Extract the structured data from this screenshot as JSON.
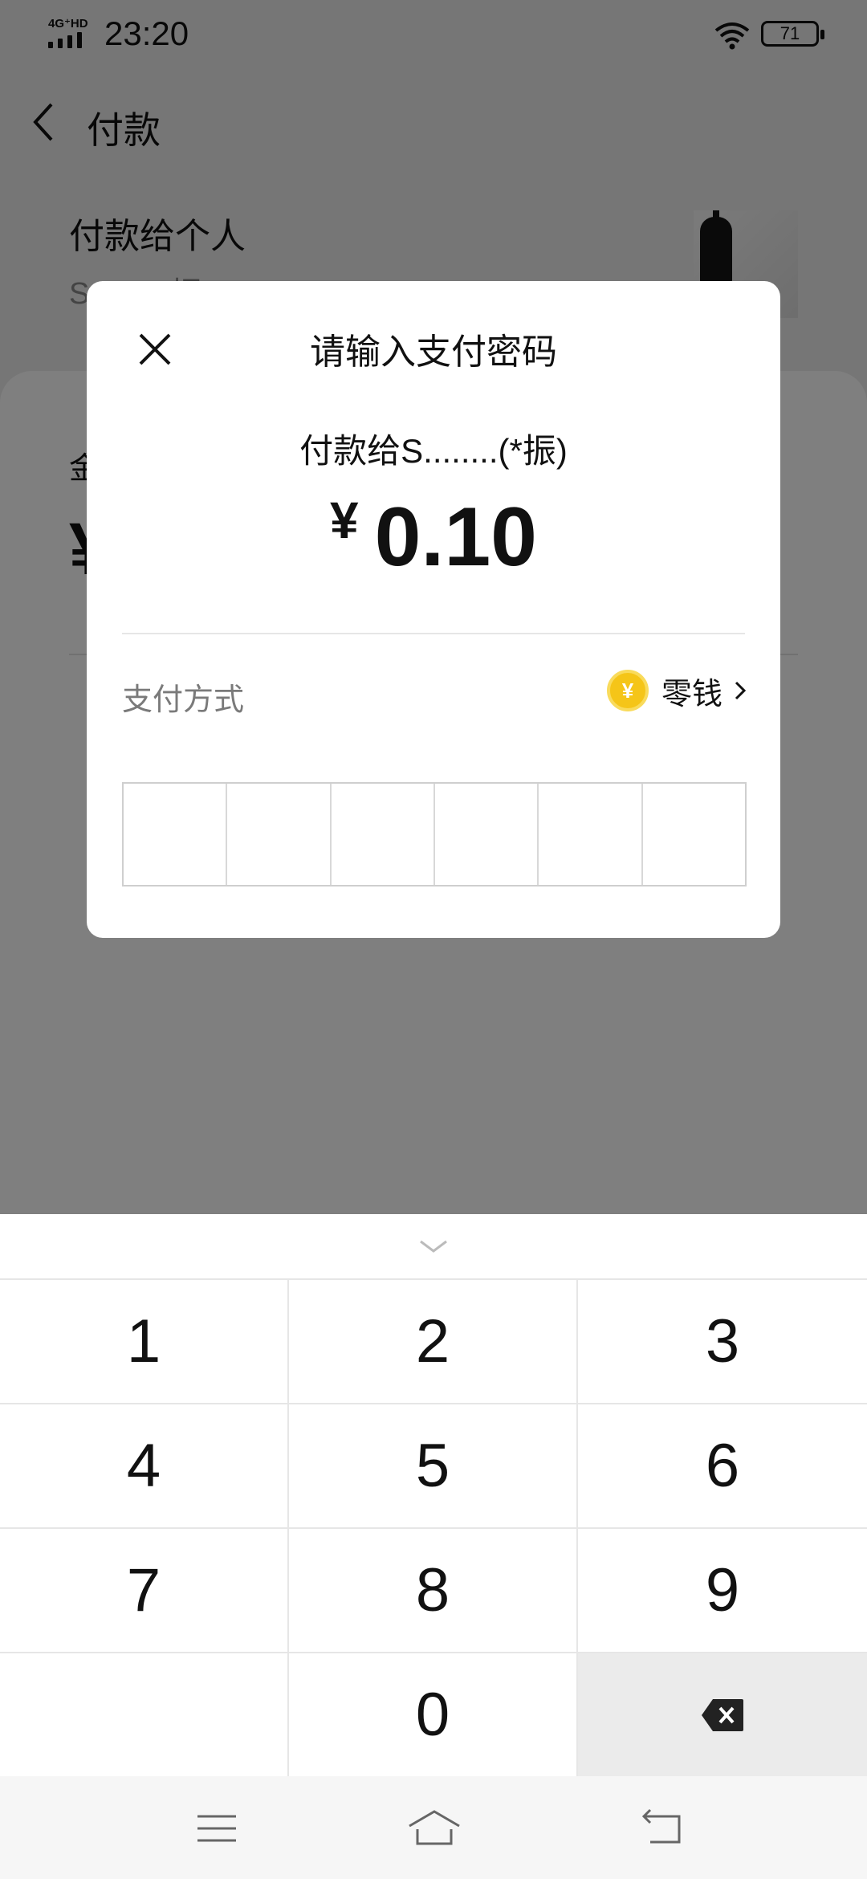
{
  "status_bar": {
    "network": "4G⁺HD",
    "time": "23:20",
    "battery": "71"
  },
  "page": {
    "title": "付款",
    "payee_title": "付款给个人",
    "payee_name": "S.......(*振)",
    "amount_label": "金额",
    "amount_symbol": "¥"
  },
  "dialog": {
    "title": "请输入支付密码",
    "payee": "付款给S........(*振)",
    "currency": "¥",
    "amount": "0.10",
    "method_label": "支付方式",
    "method_value": "零钱",
    "coin_symbol": "¥"
  },
  "keypad": {
    "keys": [
      "1",
      "2",
      "3",
      "4",
      "5",
      "6",
      "7",
      "8",
      "9",
      "",
      "0"
    ]
  },
  "colors": {
    "coin": "#f5c518",
    "overlay": "rgba(0,0,0,0.5)",
    "delete_key_bg": "#ebebeb"
  },
  "icons": {
    "back": "chevron-left-icon",
    "close": "close-icon",
    "chevron": "chevron-right-icon",
    "collapse": "chevron-down-icon",
    "delete": "backspace-icon",
    "menu": "menu-icon",
    "home": "home-icon",
    "return": "return-icon"
  }
}
